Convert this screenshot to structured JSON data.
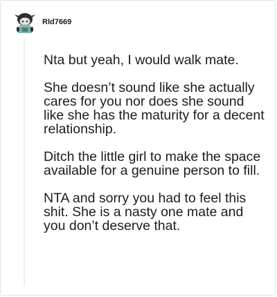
{
  "comment": {
    "username": "Rld7669",
    "paragraphs": [
      "Nta but yeah, I would walk mate.",
      "She doesn’t sound like she actually cares for you nor does she sound like she has the maturity for a decent relationship.",
      "Ditch the little girl to make the space available for a genuine person to fill.",
      "NTA and sorry you had to feel this shit. She is a nasty one mate and you don’t deserve that."
    ]
  },
  "colors": {
    "text": "#1c1c1c",
    "thread_line": "#ededed",
    "avatar_dark": "#2f2f2f",
    "avatar_teal": "#7fb5b0"
  },
  "icons": {
    "avatar": "snoo-avatar-icon"
  }
}
